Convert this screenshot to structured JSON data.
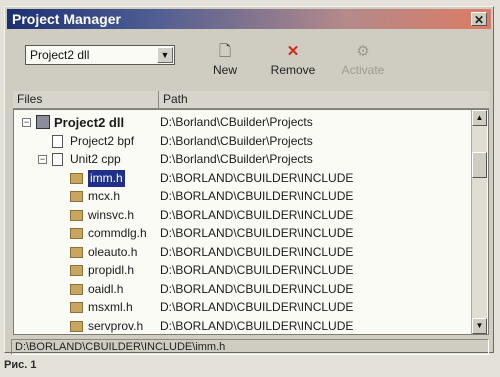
{
  "window": {
    "title": "Project Manager"
  },
  "toolbar": {
    "project_select": "Project2 dll",
    "new_label": "New",
    "remove_label": "Remove",
    "activate_label": "Activate"
  },
  "columns": {
    "files": "Files",
    "path": "Path"
  },
  "tree": [
    {
      "name": "Project2 dll",
      "path": "D:\\Borland\\CBuilder\\Projects",
      "kind": "project",
      "level": 0,
      "expander": "−",
      "bold": true
    },
    {
      "name": "Project2 bpf",
      "path": "D:\\Borland\\CBuilder\\Projects",
      "kind": "doc",
      "level": 1
    },
    {
      "name": "Unit2 cpp",
      "path": "D:\\Borland\\CBuilder\\Projects",
      "kind": "doc",
      "level": 1,
      "expander": "−"
    },
    {
      "name": "imm.h",
      "path": "D:\\BORLAND\\CBUILDER\\INCLUDE",
      "kind": "folder",
      "level": 2,
      "selected": true
    },
    {
      "name": "mcx.h",
      "path": "D:\\BORLAND\\CBUILDER\\INCLUDE",
      "kind": "folder",
      "level": 2
    },
    {
      "name": "winsvc.h",
      "path": "D:\\BORLAND\\CBUILDER\\INCLUDE",
      "kind": "folder",
      "level": 2
    },
    {
      "name": "commdlg.h",
      "path": "D:\\BORLAND\\CBUILDER\\INCLUDE",
      "kind": "folder",
      "level": 2
    },
    {
      "name": "oleauto.h",
      "path": "D:\\BORLAND\\CBUILDER\\INCLUDE",
      "kind": "folder",
      "level": 2
    },
    {
      "name": "propidl.h",
      "path": "D:\\BORLAND\\CBUILDER\\INCLUDE",
      "kind": "folder",
      "level": 2
    },
    {
      "name": "oaidl.h",
      "path": "D:\\BORLAND\\CBUILDER\\INCLUDE",
      "kind": "folder",
      "level": 2
    },
    {
      "name": "msxml.h",
      "path": "D:\\BORLAND\\CBUILDER\\INCLUDE",
      "kind": "folder",
      "level": 2
    },
    {
      "name": "servprov.h",
      "path": "D:\\BORLAND\\CBUILDER\\INCLUDE",
      "kind": "folder",
      "level": 2
    }
  ],
  "status": {
    "text": "D:\\BORLAND\\CBUILDER\\INCLUDE\\imm.h"
  },
  "caption": "Рис. 1",
  "icons": {
    "new": "new-file-icon",
    "remove": "remove-x-icon",
    "activate": "activate-icon"
  },
  "colors": {
    "selection": "#1f2f8a",
    "remove_icon": "#d02a1f"
  }
}
